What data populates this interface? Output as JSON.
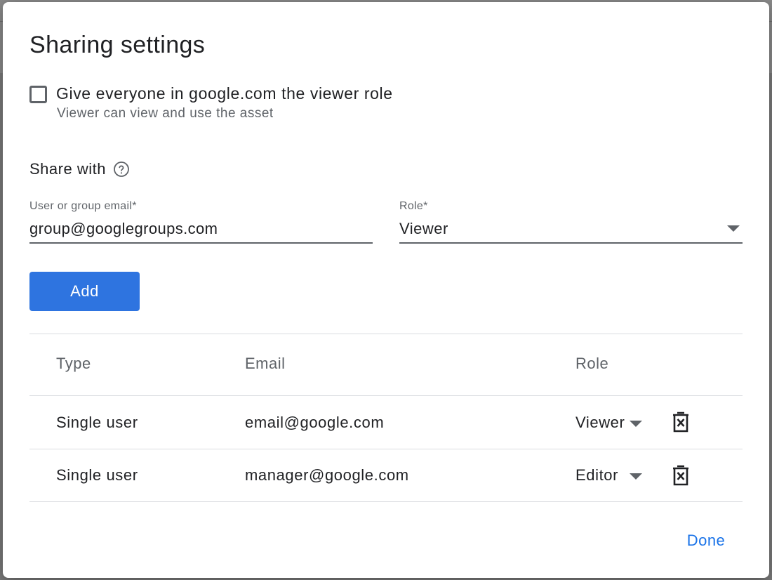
{
  "dialog": {
    "title": "Sharing settings",
    "domain_checkbox": {
      "checked": false,
      "label": "Give everyone in google.com the viewer role",
      "sublabel": "Viewer can view and use the asset"
    },
    "share_with": {
      "label": "Share with",
      "help_icon": "help-circle-icon"
    },
    "email_field": {
      "label": "User or group email*",
      "value": "group@googlegroups.com"
    },
    "role_field": {
      "label": "Role*",
      "value": "Viewer"
    },
    "add_label": "Add",
    "table": {
      "headers": {
        "type": "Type",
        "email": "Email",
        "role": "Role"
      },
      "rows": [
        {
          "type": "Single user",
          "email": "email@google.com",
          "role": "Viewer"
        },
        {
          "type": "Single user",
          "email": "manager@google.com",
          "role": "Editor"
        }
      ]
    },
    "done_label": "Done"
  },
  "colors": {
    "primary_button": "#2e74e0",
    "link_accent": "#1a73e8",
    "divider": "#dadce0",
    "secondary_text": "#5f6368"
  }
}
